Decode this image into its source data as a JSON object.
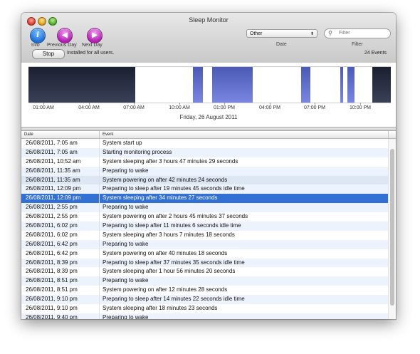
{
  "window": {
    "title": "Sleep Monitor"
  },
  "toolbar": {
    "info": {
      "label": "Info",
      "glyph": "i"
    },
    "prev": {
      "label": "Previous Day",
      "glyph": "◀"
    },
    "next": {
      "label": "Next Day",
      "glyph": "▶"
    }
  },
  "filters": {
    "date_select": {
      "value": "Other",
      "arrow": "⬍",
      "label": "Date"
    },
    "search": {
      "placeholder": "Filter",
      "label": "Filter",
      "icon": "⚲"
    }
  },
  "status": {
    "stop_label": "Stop",
    "message": "Installed for all users.",
    "events": "24 Events"
  },
  "graph": {
    "date": "Friday, 26 August 2011",
    "time_labels": [
      "01:00 AM",
      "04:00 AM",
      "07:00 AM",
      "10:00 AM",
      "01:00 PM",
      "04:00 PM",
      "07:00 PM",
      "10:00 PM"
    ],
    "colors": {
      "dark": "#1b2030",
      "blue": "#5a6ad0"
    }
  },
  "table": {
    "columns": [
      "Date",
      "Event"
    ],
    "rows": [
      {
        "date": "26/08/2011, 7:05 am",
        "event": "System start up"
      },
      {
        "date": "26/08/2011, 7:05 am",
        "event": "Starting monitoring process"
      },
      {
        "date": "26/08/2011, 10:52 am",
        "event": "System sleeping after 3 hours 47 minutes 29 seconds"
      },
      {
        "date": "26/08/2011, 11:35 am",
        "event": "Preparing to wake"
      },
      {
        "date": "26/08/2011, 11:35 am",
        "event": "System powering on after 42 minutes 24 seconds"
      },
      {
        "date": "26/08/2011, 12:09 pm",
        "event": "Preparing to sleep after 19 minutes 45 seconds idle time"
      },
      {
        "date": "26/08/2011, 12:09 pm",
        "event": "System sleeping after 34 minutes 27 seconds"
      },
      {
        "date": "26/08/2011, 2:55 pm",
        "event": "Preparing to wake"
      },
      {
        "date": "26/08/2011, 2:55 pm",
        "event": "System powering on after 2 hours 45 minutes 37 seconds"
      },
      {
        "date": "26/08/2011, 6:02 pm",
        "event": "Preparing to sleep after 11 minutes 6 seconds idle time"
      },
      {
        "date": "26/08/2011, 6:02 pm",
        "event": "System sleeping after 3 hours 7 minutes 18 seconds"
      },
      {
        "date": "26/08/2011, 6:42 pm",
        "event": "Preparing to wake"
      },
      {
        "date": "26/08/2011, 6:42 pm",
        "event": "System powering on after 40 minutes 18 seconds"
      },
      {
        "date": "26/08/2011, 8:39 pm",
        "event": "Preparing to sleep after 37 minutes 35 seconds idle time"
      },
      {
        "date": "26/08/2011, 8:39 pm",
        "event": "System sleeping after 1 hour 56 minutes 20 seconds"
      },
      {
        "date": "26/08/2011, 8:51 pm",
        "event": "Preparing to wake"
      },
      {
        "date": "26/08/2011, 8:51 pm",
        "event": "System powering on after 12 minutes 28 seconds"
      },
      {
        "date": "26/08/2011, 9:10 pm",
        "event": "Preparing to sleep after 14 minutes 22 seconds idle time"
      },
      {
        "date": "26/08/2011, 9:10 pm",
        "event": "System sleeping after 18 minutes 23 seconds"
      },
      {
        "date": "26/08/2011, 9:40 pm",
        "event": "Preparing to wake"
      }
    ]
  }
}
